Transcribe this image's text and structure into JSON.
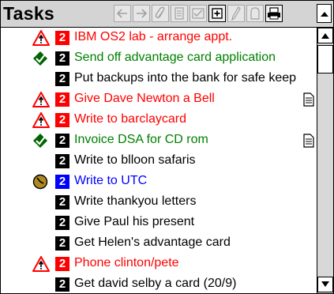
{
  "window": {
    "title": "Tasks"
  },
  "toolbar": {
    "buttons": [
      {
        "name": "back-arrow-icon",
        "enabled": false
      },
      {
        "name": "forward-arrow-icon",
        "enabled": false
      },
      {
        "name": "paperclip-icon",
        "enabled": false
      },
      {
        "name": "document-icon",
        "enabled": false
      },
      {
        "name": "checkbox-icon",
        "enabled": false
      },
      {
        "name": "add-item-icon",
        "enabled": true
      },
      {
        "name": "pen-icon",
        "enabled": false
      },
      {
        "name": "eraser-icon",
        "enabled": false
      },
      {
        "name": "printer-icon",
        "enabled": true
      }
    ]
  },
  "colors": {
    "urgent": "#ff0000",
    "done": "#008000",
    "normal": "#000000",
    "active": "#0000ff",
    "priority_blue_box": "#0000ff"
  },
  "tasks": [
    {
      "status": "alarm",
      "priority": "2",
      "text": "IBM OS2 lab - arrange appt.",
      "color": "#ff0000",
      "note": false
    },
    {
      "status": "done",
      "priority": "2",
      "text": "Send off advantage card application",
      "color": "#008000",
      "note": false
    },
    {
      "status": "none",
      "priority": "2",
      "text": "Put backups into the bank for safe keep",
      "color": "#000000",
      "note": false
    },
    {
      "status": "alarm",
      "priority": "2",
      "text": "Give Dave Newton a Bell",
      "color": "#ff0000",
      "note": true
    },
    {
      "status": "alarm",
      "priority": "2",
      "text": "Write to barclaycard",
      "color": "#ff0000",
      "note": false
    },
    {
      "status": "done",
      "priority": "2",
      "text": "Invoice DSA for CD rom",
      "color": "#008000",
      "note": true
    },
    {
      "status": "none",
      "priority": "2",
      "text": "Write to blloon safaris",
      "color": "#000000",
      "note": false
    },
    {
      "status": "clock",
      "priority": "2",
      "text": "Write to UTC",
      "color": "#0000ff",
      "note": false
    },
    {
      "status": "none",
      "priority": "2",
      "text": "Write thankyou letters",
      "color": "#000000",
      "note": false
    },
    {
      "status": "none",
      "priority": "2",
      "text": "Give Paul his present",
      "color": "#000000",
      "note": false
    },
    {
      "status": "none",
      "priority": "2",
      "text": "Get Helen's advantage card",
      "color": "#000000",
      "note": false
    },
    {
      "status": "alarm",
      "priority": "2",
      "text": "Phone clinton/pete",
      "color": "#ff0000",
      "note": false
    },
    {
      "status": "none",
      "priority": "2",
      "text": "Get david selby a card (20/9)",
      "color": "#000000",
      "note": false
    }
  ]
}
